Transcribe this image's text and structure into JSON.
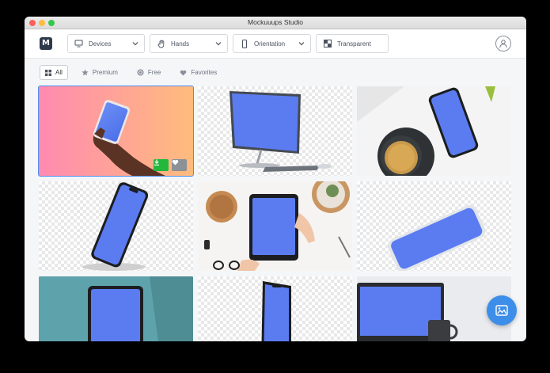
{
  "window": {
    "title": "Mockuuups Studio"
  },
  "toolbar": {
    "logo_letter": "M",
    "devices_label": "Devices",
    "hands_label": "Hands",
    "orientation_label": "Orientation",
    "transparent_label": "Transparent"
  },
  "filters": [
    {
      "label": "All",
      "icon": "grid-icon",
      "active": true
    },
    {
      "label": "Premium",
      "icon": "star-icon",
      "active": false
    },
    {
      "label": "Free",
      "icon": "coin-icon",
      "active": false
    },
    {
      "label": "Favorites",
      "icon": "heart-icon",
      "active": false
    }
  ],
  "colors": {
    "accent": "#3d8ee8",
    "download": "#21b83c",
    "screen": "#5b7cf0"
  }
}
